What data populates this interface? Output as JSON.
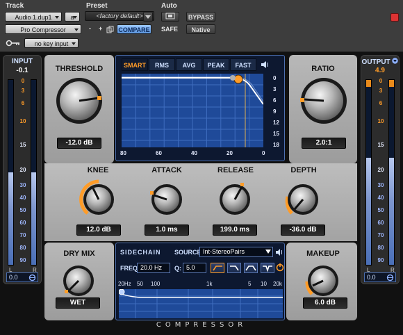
{
  "header": {
    "track_label": "Track",
    "preset_label": "Preset",
    "auto_label": "Auto",
    "track_name": "Audio 1.dup1",
    "track_channel": "a",
    "preset_name": "<factory default>",
    "plugin_name": "Pro Compressor",
    "minus": "-",
    "plus": "+",
    "compare": "COMPARE",
    "safe": "SAFE",
    "bypass": "BYPASS",
    "native": "Native",
    "key_input": "no key input"
  },
  "meters": {
    "input": {
      "title": "INPUT",
      "peak": "-0.1",
      "value": "0.0",
      "level": 0.5,
      "scale": [
        "0",
        "3",
        "6",
        "10",
        "15",
        "20",
        "30",
        "40",
        "50",
        "60",
        "70",
        "80",
        "90"
      ]
    },
    "output": {
      "title": "OUTPUT",
      "peak": "4.9",
      "value": "0.0",
      "level": 0.58,
      "scale": [
        "0",
        "3",
        "6",
        "10",
        "15",
        "20",
        "30",
        "40",
        "50",
        "60",
        "70",
        "80",
        "90"
      ]
    },
    "left": "L",
    "right": "R"
  },
  "threshold": {
    "title": "THRESHOLD",
    "value": "-12.0 dB"
  },
  "ratio": {
    "title": "RATIO",
    "value": "2.0:1"
  },
  "graph": {
    "tabs": [
      "SMART",
      "RMS",
      "AVG",
      "PEAK",
      "FAST"
    ],
    "active_tab": "SMART",
    "x_ticks": [
      "80",
      "60",
      "40",
      "20",
      "0"
    ],
    "y_ticks": [
      "0",
      "3",
      "6",
      "9",
      "12",
      "15",
      "18"
    ]
  },
  "knee": {
    "title": "KNEE",
    "value": "12.0 dB"
  },
  "attack": {
    "title": "ATTACK",
    "value": "1.0 ms"
  },
  "release": {
    "title": "RELEASE",
    "value": "199.0 ms"
  },
  "depth": {
    "title": "DEPTH",
    "value": "-36.0 dB"
  },
  "drymix": {
    "title": "DRY MIX",
    "value": "WET"
  },
  "makeup": {
    "title": "MAKEUP",
    "value": "6.0 dB"
  },
  "sidechain": {
    "title": "SIDECHAIN",
    "source_label": "SOURCE:",
    "source_value": "Int-StereoPairs",
    "freq_label": "FREQ:",
    "freq_value": "20.0 Hz",
    "q_label": "Q:",
    "q_value": "5.0",
    "axis": [
      "20Hz",
      "50",
      "100",
      "1k",
      "5",
      "10",
      "20k"
    ]
  },
  "footer": "COMPRESSOR",
  "colors": {
    "accent": "#ff9c28",
    "panel_blue": "#0d1830",
    "meter_fill": "#7c95cd"
  }
}
